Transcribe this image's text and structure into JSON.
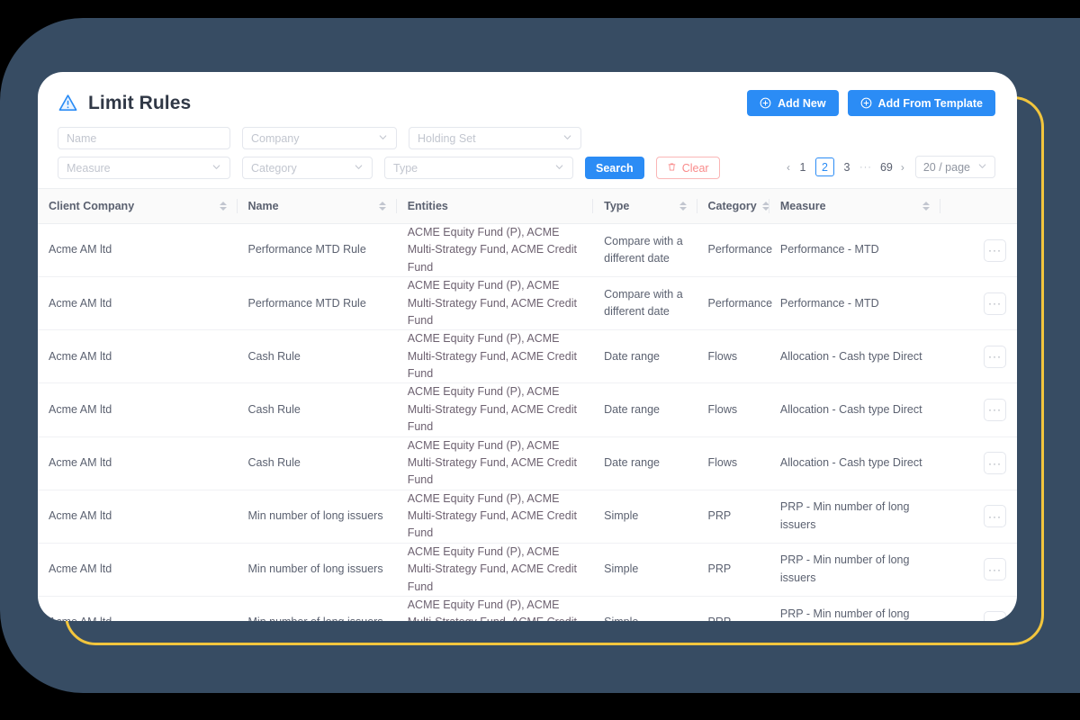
{
  "theme": {
    "backdrop_color": "#374c63",
    "accent_frame_color": "#f2c53d",
    "primary_color": "#2b8cf5",
    "danger_color": "#f98b8b",
    "card_color": "#ffffff"
  },
  "header": {
    "title": "Limit Rules",
    "warning_icon": "warning-triangle-icon",
    "buttons": [
      {
        "label": "Add New",
        "icon": "plus-circle-icon"
      },
      {
        "label": "Add From Template",
        "icon": "plus-circle-icon"
      }
    ]
  },
  "filters": {
    "row1": [
      {
        "name": "name",
        "placeholder": "Name",
        "type": "text"
      },
      {
        "name": "company",
        "placeholder": "Company",
        "type": "select"
      },
      {
        "name": "holding-set",
        "placeholder": "Holding Set",
        "type": "select"
      }
    ],
    "row2": [
      {
        "name": "measure",
        "placeholder": "Measure",
        "type": "select"
      },
      {
        "name": "category",
        "placeholder": "Category",
        "type": "select"
      },
      {
        "name": "type",
        "placeholder": "Type",
        "type": "select"
      }
    ],
    "search_label": "Search",
    "clear_label": "Clear",
    "clear_icon": "trash-icon"
  },
  "pagination": {
    "prev_icon": "chevron-left-icon",
    "next_icon": "chevron-right-icon",
    "pages": [
      "1",
      "2",
      "3"
    ],
    "ellipsis": "···",
    "last_page": "69",
    "current_page": "2",
    "page_size_label": "20 / page"
  },
  "table": {
    "columns": [
      {
        "key": "client_company",
        "label": "Client Company",
        "sortable": true
      },
      {
        "key": "name",
        "label": "Name",
        "sortable": true
      },
      {
        "key": "entities",
        "label": "Entities",
        "sortable": false
      },
      {
        "key": "type",
        "label": "Type",
        "sortable": true
      },
      {
        "key": "category",
        "label": "Category",
        "sortable": true
      },
      {
        "key": "measure",
        "label": "Measure",
        "sortable": true
      },
      {
        "key": "actions",
        "label": "",
        "sortable": false
      }
    ],
    "action_button_label": "···",
    "rows": [
      {
        "client_company": "Acme AM ltd",
        "name": "Performance MTD Rule",
        "entities": "ACME Equity Fund (P), ACME Multi-Strategy Fund, ACME Credit Fund",
        "type": "Compare with a different date",
        "category": "Performance",
        "measure": "Performance - MTD"
      },
      {
        "client_company": "Acme AM ltd",
        "name": "Performance MTD Rule",
        "entities": "ACME Equity Fund (P), ACME Multi-Strategy Fund, ACME Credit Fund",
        "type": "Compare with a different date",
        "category": "Performance",
        "measure": "Performance - MTD"
      },
      {
        "client_company": "Acme AM ltd",
        "name": "Cash Rule",
        "entities": "ACME Equity Fund (P), ACME Multi-Strategy Fund, ACME Credit Fund",
        "type": "Date range",
        "category": "Flows",
        "measure": "Allocation - Cash type Direct"
      },
      {
        "client_company": "Acme AM ltd",
        "name": "Cash Rule",
        "entities": "ACME Equity Fund (P), ACME Multi-Strategy Fund, ACME Credit Fund",
        "type": "Date range",
        "category": "Flows",
        "measure": "Allocation - Cash type Direct"
      },
      {
        "client_company": "Acme AM ltd",
        "name": "Cash Rule",
        "entities": "ACME Equity Fund (P), ACME Multi-Strategy Fund, ACME Credit Fund",
        "type": "Date range",
        "category": "Flows",
        "measure": "Allocation - Cash type Direct"
      },
      {
        "client_company": "Acme AM ltd",
        "name": "Min number of long issuers",
        "entities": "ACME Equity Fund (P), ACME Multi-Strategy Fund, ACME Credit Fund",
        "type": "Simple",
        "category": "PRP",
        "measure": "PRP - Min number of long issuers"
      },
      {
        "client_company": "Acme AM ltd",
        "name": "Min number of long issuers",
        "entities": "ACME Equity Fund (P), ACME Multi-Strategy Fund, ACME Credit Fund",
        "type": "Simple",
        "category": "PRP",
        "measure": "PRP - Min number of long issuers"
      },
      {
        "client_company": "Acme AM ltd",
        "name": "Min number of long issuers",
        "entities": "ACME Equity Fund (P), ACME Multi-Strategy Fund, ACME Credit Fund",
        "type": "Simple",
        "category": "PRP",
        "measure": "PRP - Min number of long issuers"
      }
    ]
  }
}
